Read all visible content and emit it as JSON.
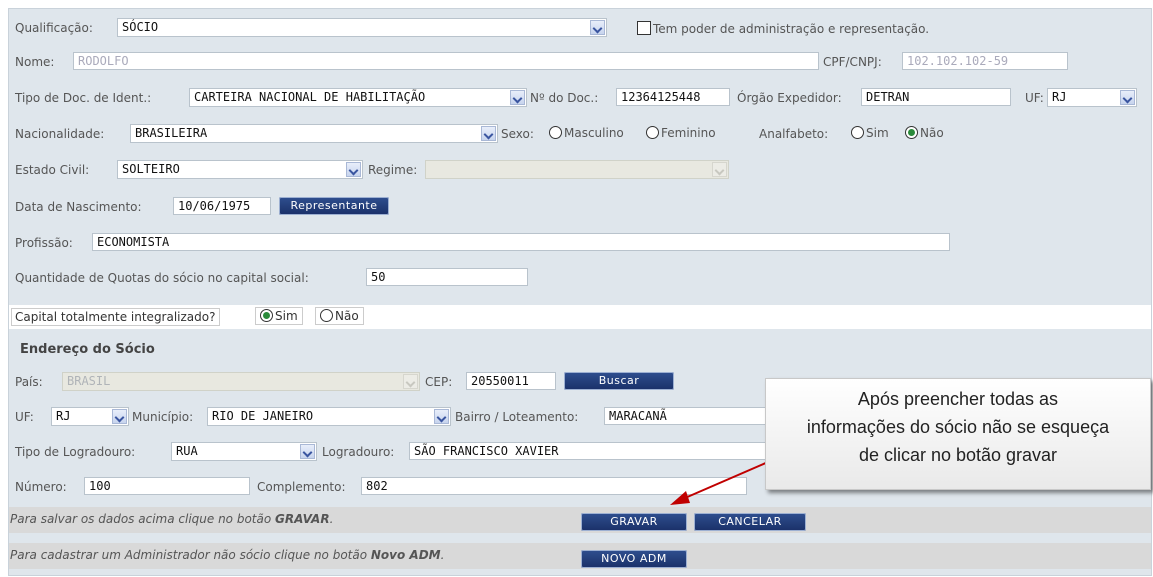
{
  "socio": {
    "qualificacao_label": "Qualificação:",
    "qualificacao_value": "SÓCIO",
    "poder_label": "Tem poder de administração e representação.",
    "nome_label": "Nome:",
    "nome_value": "RODOLFO",
    "cpf_label": "CPF/CNPJ:",
    "cpf_value": "102.102.102-59",
    "tipo_doc_label": "Tipo de Doc. de Ident.:",
    "tipo_doc_value": "CARTEIRA NACIONAL DE HABILITAÇÃO",
    "num_doc_label": "Nº do Doc.:",
    "num_doc_value": "12364125448",
    "orgao_label": "Órgão Expedidor:",
    "orgao_value": "DETRAN",
    "uf_label": "UF:",
    "uf_value": "RJ",
    "nacionalidade_label": "Nacionalidade:",
    "nacionalidade_value": "BRASILEIRA",
    "sexo_label": "Sexo:",
    "sexo_masc": "Masculino",
    "sexo_fem": "Feminino",
    "analfabeto_label": "Analfabeto:",
    "sim": "Sim",
    "nao": "Não",
    "estado_civil_label": "Estado Civil:",
    "estado_civil_value": "SOLTEIRO",
    "regime_label": "Regime:",
    "nascimento_label": "Data de Nascimento:",
    "nascimento_value": "10/06/1975",
    "representante_btn": "Representante",
    "profissao_label": "Profissão:",
    "profissao_value": "ECONOMISTA",
    "quotas_label": "Quantidade de Quotas do sócio no capital social:",
    "quotas_value": "50",
    "capital_label": "Capital totalmente integralizado?"
  },
  "endereco": {
    "title": "Endereço do Sócio",
    "pais_label": "País:",
    "pais_value": "BRASIL",
    "cep_label": "CEP:",
    "cep_value": "20550011",
    "buscar_btn": "Buscar",
    "uf_label": "UF:",
    "uf_value": "RJ",
    "municipio_label": "Município:",
    "municipio_value": "RIO DE JANEIRO",
    "bairro_label": "Bairro / Loteamento:",
    "bairro_value": "MARACANÃ",
    "tipo_logradouro_label": "Tipo de Logradouro:",
    "tipo_logradouro_value": "RUA",
    "logradouro_label": "Logradouro:",
    "logradouro_value": "SÃO FRANCISCO XAVIER",
    "numero_label": "Número:",
    "numero_value": "100",
    "complemento_label": "Complemento:",
    "complemento_value": "802"
  },
  "actions": {
    "save_note_prefix": "Para salvar os dados acima clique no botão ",
    "save_note_bold": "GRAVAR",
    "save_note_suffix": ".",
    "gravar_btn": "GRAVAR",
    "cancelar_btn": "CANCELAR",
    "adm_note_prefix": "Para cadastrar um Administrador não sócio clique no botão ",
    "adm_note_bold": "Novo ADM",
    "adm_note_suffix": ".",
    "novo_adm_btn": "NOVO ADM"
  },
  "callout": {
    "line1": "Após preencher todas as",
    "line2": "informações do sócio não se esqueça",
    "line3": "de clicar no botão gravar"
  },
  "colors": {
    "form_bg": "#dfe6ec",
    "button_bg": "#1f3a78",
    "radio_selected": "#2a8a3a",
    "arrow": "#c00000"
  }
}
